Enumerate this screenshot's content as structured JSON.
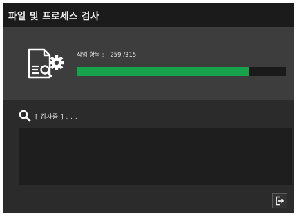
{
  "window": {
    "title": "파일 및 프로세스 검사"
  },
  "progress": {
    "label": "작업 항목 :",
    "count": "259 /315",
    "current": 259,
    "total": 315
  },
  "status": {
    "text": "[ 검사중 ] . . ."
  },
  "icons": {
    "file_scan": "file-gear-scan-icon",
    "search": "search-icon",
    "exit": "exit-icon"
  },
  "colors": {
    "progress_fill": "#17a24c",
    "title_bar": "#1b1b1b",
    "panel": "#3d3d3d"
  }
}
